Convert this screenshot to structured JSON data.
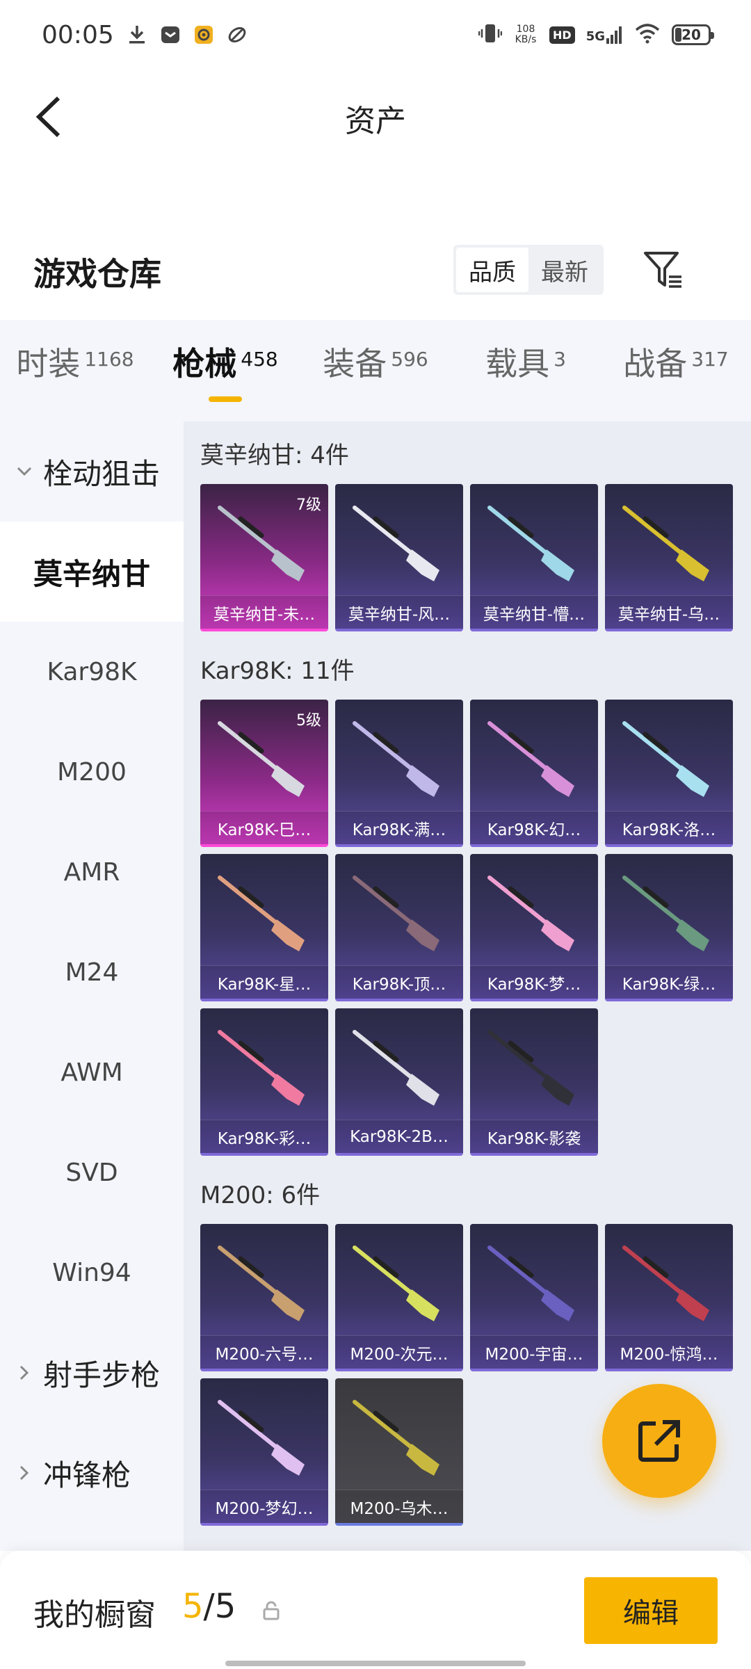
{
  "status_bar": {
    "time": "00:05",
    "net_speed_value": "108",
    "net_speed_unit": "KB/s",
    "hd": "HD",
    "network": "5G",
    "battery": "20"
  },
  "header": {
    "title": "资产"
  },
  "warehouse": {
    "title": "游戏仓库",
    "sort_options": [
      "品质",
      "最新"
    ]
  },
  "tabs": [
    {
      "label": "时装",
      "count": "1168",
      "active": false
    },
    {
      "label": "枪械",
      "count": "458",
      "active": true
    },
    {
      "label": "装备",
      "count": "596",
      "active": false
    },
    {
      "label": "载具",
      "count": "3",
      "active": false
    },
    {
      "label": "战备",
      "count": "317",
      "active": false
    }
  ],
  "sidebar": {
    "items": [
      {
        "label": "栓动狙击",
        "type": "group"
      },
      {
        "label": "莫辛纳甘",
        "type": "active"
      },
      {
        "label": "Kar98K",
        "type": "item"
      },
      {
        "label": "M200",
        "type": "item"
      },
      {
        "label": "AMR",
        "type": "item"
      },
      {
        "label": "M24",
        "type": "item"
      },
      {
        "label": "AWM",
        "type": "item"
      },
      {
        "label": "SVD",
        "type": "item"
      },
      {
        "label": "Win94",
        "type": "item"
      },
      {
        "label": "射手步枪",
        "type": "group"
      },
      {
        "label": "冲锋枪",
        "type": "group"
      }
    ]
  },
  "sections": [
    {
      "title": "莫辛纳甘: 4件",
      "items": [
        {
          "name": "莫辛纳甘-未…",
          "level": "7级",
          "style": "pink",
          "tint": "#b8c2cc"
        },
        {
          "name": "莫辛纳甘-风…",
          "level": "",
          "style": "purple",
          "tint": "#e8e8f0"
        },
        {
          "name": "莫辛纳甘-懵…",
          "level": "",
          "style": "purple",
          "tint": "#9fd8e8"
        },
        {
          "name": "莫辛纳甘-乌…",
          "level": "",
          "style": "purple",
          "tint": "#d8c030"
        }
      ]
    },
    {
      "title": "Kar98K: 11件",
      "items": [
        {
          "name": "Kar98K-巳…",
          "level": "5级",
          "style": "pink",
          "tint": "#d8d8e0"
        },
        {
          "name": "Kar98K-满…",
          "level": "",
          "style": "purple",
          "tint": "#c0b8e8"
        },
        {
          "name": "Kar98K-幻…",
          "level": "",
          "style": "purple",
          "tint": "#d890d8"
        },
        {
          "name": "Kar98K-洛…",
          "level": "",
          "style": "purple",
          "tint": "#a8e0f0"
        },
        {
          "name": "Kar98K-星…",
          "level": "",
          "style": "purple",
          "tint": "#e0a080"
        },
        {
          "name": "Kar98K-顶…",
          "level": "",
          "style": "purple",
          "tint": "#8a6a78"
        },
        {
          "name": "Kar98K-梦…",
          "level": "",
          "style": "purple",
          "tint": "#f0a0d0"
        },
        {
          "name": "Kar98K-绿…",
          "level": "",
          "style": "purple",
          "tint": "#6a9a80"
        },
        {
          "name": "Kar98K-彩…",
          "level": "",
          "style": "purple",
          "tint": "#f07aa0"
        },
        {
          "name": "Kar98K-2B…",
          "level": "",
          "style": "purple",
          "tint": "#e0e0e8"
        },
        {
          "name": "Kar98K-影袭",
          "level": "",
          "style": "purple",
          "tint": "#303038"
        }
      ]
    },
    {
      "title": "M200: 6件",
      "items": [
        {
          "name": "M200-六号…",
          "level": "",
          "style": "purple",
          "tint": "#c8a070"
        },
        {
          "name": "M200-次元…",
          "level": "",
          "style": "purple",
          "tint": "#d8e060"
        },
        {
          "name": "M200-宇宙…",
          "level": "",
          "style": "purple",
          "tint": "#6a60c0"
        },
        {
          "name": "M200-惊鸿…",
          "level": "",
          "style": "purple",
          "tint": "#c04050"
        },
        {
          "name": "M200-梦幻…",
          "level": "",
          "style": "purple",
          "tint": "#e0c0f0"
        },
        {
          "name": "M200-乌木…",
          "level": "",
          "style": "gray",
          "tint": "#c8b840"
        }
      ]
    }
  ],
  "bottom": {
    "showcase_label": "我的橱窗",
    "showcase_current": "5",
    "showcase_separator": "/",
    "showcase_total": "5",
    "edit_label": "编辑"
  },
  "icons": {
    "back": "chevron-left-icon",
    "filter": "filter-icon",
    "share": "share-icon",
    "lock": "lock-icon",
    "group_expanded": "chevron-down-icon",
    "group_collapsed": "chevron-right-icon"
  },
  "colors": {
    "accent": "#f7b400",
    "rare_card": "#d43fc8",
    "epic_card": "#5a4aa0"
  }
}
